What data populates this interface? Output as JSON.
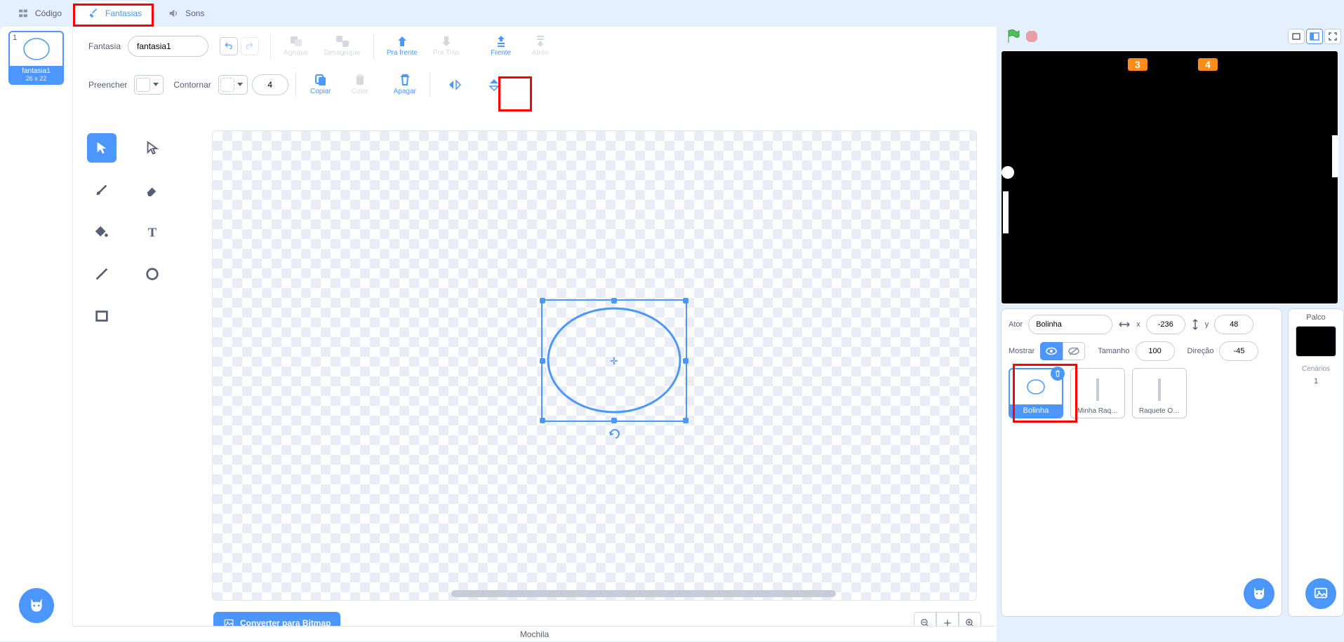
{
  "tabs": {
    "code": "Código",
    "costumes": "Fantasias",
    "sounds": "Sons",
    "active": "costumes"
  },
  "costume_list": {
    "items": [
      {
        "index": "1",
        "name": "fantasia1",
        "dims": "26 x 22"
      }
    ]
  },
  "toolbar": {
    "costume_label": "Fantasia",
    "costume_name": "fantasia1",
    "group": "Agrupar",
    "ungroup": "Desagrupar",
    "forward": "Pra frente",
    "backward": "Pra Trás",
    "front": "Frente",
    "back": "Atrás",
    "fill_label": "Preencher",
    "outline_label": "Contornar",
    "outline_width": "4",
    "copy": "Copiar",
    "paste": "Colar",
    "delete": "Apagar",
    "convert": "Converter para Bitmap"
  },
  "tools": {
    "select": "Select",
    "reshape": "Reshape",
    "brush": "Brush",
    "eraser": "Eraser",
    "fill": "Fill",
    "text": "Text",
    "line": "Line",
    "circle": "Circle",
    "rect": "Rectangle"
  },
  "stage": {
    "markers": [
      "3",
      "4"
    ]
  },
  "sprite_info": {
    "ator_label": "Ator",
    "name": "Bolinha",
    "x_label": "x",
    "x": "-236",
    "y_label": "y",
    "y": "48",
    "mostrar_label": "Mostrar",
    "tamanho_label": "Tamanho",
    "size": "100",
    "direcao_label": "Direção",
    "direction": "-45"
  },
  "sprites": [
    {
      "name": "Bolinha",
      "active": true
    },
    {
      "name": "Minha Raq…",
      "active": false
    },
    {
      "name": "Raquete O…",
      "active": false
    }
  ],
  "palco": {
    "title": "Palco",
    "cenarios_label": "Cenários",
    "cenarios_count": "1"
  },
  "backpack": "Mochila"
}
